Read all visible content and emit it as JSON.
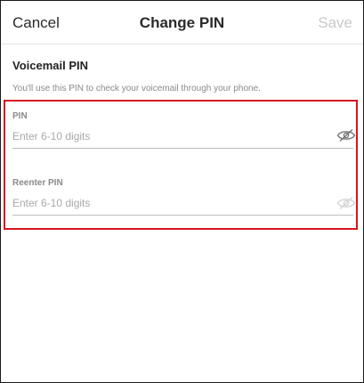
{
  "nav": {
    "cancel_label": "Cancel",
    "title": "Change PIN",
    "save_label": "Save"
  },
  "section": {
    "title": "Voicemail PIN",
    "description": "You'll use this PIN to check your voicemail through your phone."
  },
  "fields": [
    {
      "label": "PIN",
      "placeholder": "Enter 6-10 digits",
      "value": "",
      "toggle_icon": "eye-slash-icon"
    },
    {
      "label": "Reenter PIN",
      "placeholder": "Enter 6-10 digits",
      "value": "",
      "toggle_icon": "eye-slash-icon"
    }
  ],
  "colors": {
    "highlight_border": "#d6161d",
    "save_disabled": "#c9c9c9"
  }
}
